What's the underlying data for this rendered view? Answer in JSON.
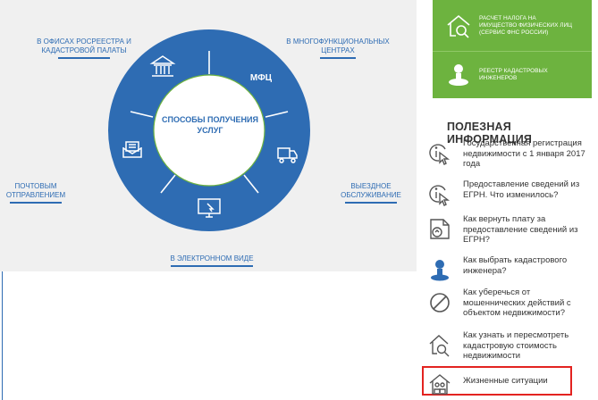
{
  "colors": {
    "primary_blue": "#2e6cb3",
    "green": "#6db33f",
    "highlight_red": "#e32320",
    "panel_gray": "#f0f0f0"
  },
  "channels": {
    "offices": {
      "line1": "В ОФИСАХ РОСРЕЕСТРА И",
      "line2": "КАДАСТРОВОЙ ПАЛАТЫ"
    },
    "mfc": {
      "line1": "В МНОГОФУНКЦИОНАЛЬНЫХ",
      "line2": "ЦЕНТРАХ"
    },
    "mail": {
      "line1": "ПОЧТОВЫМ",
      "line2": "ОТПРАВЛЕНИЕМ"
    },
    "visit": {
      "line1": "ВЫЕЗДНОЕ",
      "line2": "ОБСЛУЖИВАНИЕ"
    },
    "electronic": {
      "line1": "В ЭЛЕКТРОННОМ ВИДЕ"
    }
  },
  "ring": {
    "mfc_label": "МФЦ",
    "center_line1": "СПОСОБЫ ПОЛУЧЕНИЯ",
    "center_line2": "УСЛУГ",
    "icons": [
      "bank-icon",
      "mfc-badge",
      "truck-icon",
      "computer-icon",
      "mail-envelope-icon"
    ]
  },
  "side_buttons": [
    {
      "icon": "house-search-icon",
      "line1": "РАСЧЕТ НАЛОГА НА",
      "line2": "ИМУЩЕСТВО ФИЗИЧЕСКИХ ЛИЦ",
      "line3": "(СЕРВИС ФНС РОССИИ)"
    },
    {
      "icon": "engineer-stamp-icon",
      "line1": "РЕЕСТР КАДАСТРОВЫХ",
      "line2": "ИНЖЕНЕРОВ"
    }
  ],
  "useful_info": {
    "title": "ПОЛЕЗНАЯ ИНФОРМАЦИЯ",
    "items": [
      {
        "icon": "info-cursor-icon",
        "lines": [
          "Государственная регистрация",
          "недвижимости с 1 января 2017",
          "года"
        ]
      },
      {
        "icon": "info-cursor-icon",
        "lines": [
          "Предоставление сведений из",
          "ЕГРН. Что изменилось?"
        ]
      },
      {
        "icon": "refund-document-icon",
        "lines": [
          "Как вернуть плату за",
          "предоставление сведений из",
          "ЕГРН?"
        ]
      },
      {
        "icon": "engineer-icon",
        "lines": [
          "Как выбрать кадастрового",
          "инженера?"
        ]
      },
      {
        "icon": "prohibition-icon",
        "lines": [
          "Как уберечься от",
          "мошеннических действий с",
          "объектом недвижимости?"
        ]
      },
      {
        "icon": "house-search-icon",
        "lines": [
          "Как узнать и пересмотреть",
          "кадастровую стоимость",
          "недвижимости"
        ]
      },
      {
        "icon": "house-people-icon",
        "lines": [
          "Жизненные ситуации"
        ]
      }
    ]
  }
}
